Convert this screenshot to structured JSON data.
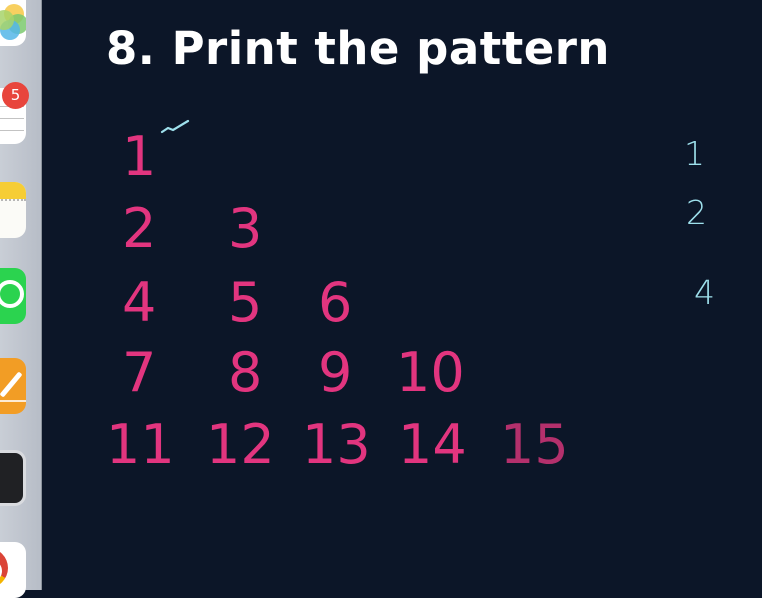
{
  "dock": {
    "badge_count": "5",
    "apps": [
      {
        "name": "Photos",
        "icon": "photos-icon"
      },
      {
        "name": "Reminders",
        "icon": "reminders-icon"
      },
      {
        "name": "Notes",
        "icon": "notes-icon"
      },
      {
        "name": "WhatsApp",
        "icon": "whatsapp-icon"
      },
      {
        "name": "Pages",
        "icon": "pages-icon"
      },
      {
        "name": "Terminal",
        "icon": "terminal-icon"
      },
      {
        "name": "Chrome",
        "icon": "chrome-icon"
      }
    ]
  },
  "slide": {
    "title": "8. Print the pattern",
    "rows": [
      [
        "1"
      ],
      [
        "2",
        "3"
      ],
      [
        "4",
        "5",
        "6"
      ],
      [
        "7",
        "8",
        "9",
        "10"
      ],
      [
        "11",
        "12",
        "13",
        "14",
        "15"
      ]
    ],
    "side_notes": [
      "1",
      "2",
      "4"
    ],
    "colors": {
      "background": "#0c1628",
      "title": "#ffffff",
      "pattern_numbers": "#e2357f",
      "handwritten_notes": "#9ee0ec"
    }
  }
}
